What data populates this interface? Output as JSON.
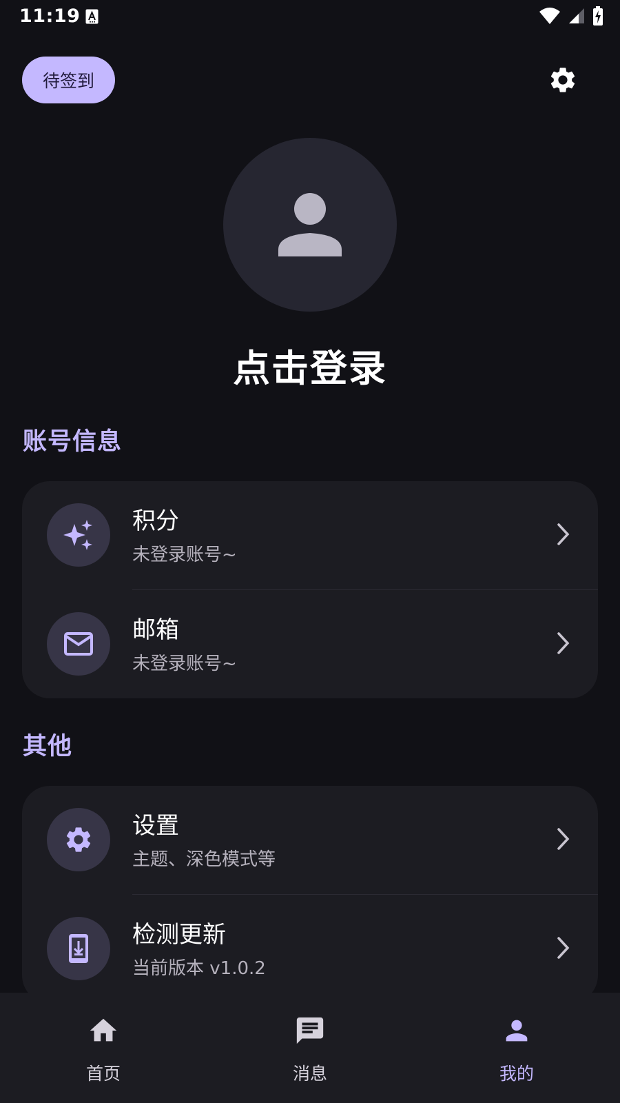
{
  "status_bar": {
    "time": "11:19"
  },
  "header": {
    "checkin_label": "待签到"
  },
  "profile": {
    "login_prompt": "点击登录"
  },
  "sections": {
    "account": {
      "title": "账号信息",
      "items": [
        {
          "title": "积分",
          "subtitle": "未登录账号~",
          "icon": "sparkle-icon"
        },
        {
          "title": "邮箱",
          "subtitle": "未登录账号~",
          "icon": "mail-icon"
        }
      ]
    },
    "other": {
      "title": "其他",
      "items": [
        {
          "title": "设置",
          "subtitle": "主题、深色模式等",
          "icon": "gear-icon"
        },
        {
          "title": "检测更新",
          "subtitle": "当前版本 v1.0.2",
          "icon": "phone-download-icon"
        }
      ]
    }
  },
  "bottom_nav": {
    "items": [
      {
        "label": "首页",
        "icon": "home-icon"
      },
      {
        "label": "消息",
        "icon": "message-icon"
      },
      {
        "label": "我的",
        "icon": "person-icon",
        "active": true
      }
    ]
  },
  "colors": {
    "background": "#111116",
    "surface": "#1c1c22",
    "accent": "#c4b8ff",
    "icon_container": "#373547"
  }
}
